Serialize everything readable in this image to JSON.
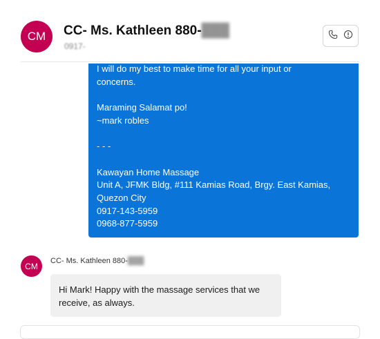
{
  "colors": {
    "avatar": "#c30052",
    "outgoing_bubble": "#0a74d9",
    "incoming_bubble": "#f0f0f0",
    "divider": "#e6e6e6"
  },
  "header": {
    "avatar_initials": "CM",
    "chat_name": "CC- Ms. Kathleen 880-",
    "chat_subtitle": "0917-",
    "call_icon": "phone-icon",
    "info_icon": "info-icon"
  },
  "outgoing_message": {
    "lines": [
      "I will do my best to make time for all your input or",
      "concerns.",
      "",
      "Maraming Salamat po!",
      "~mark robles",
      "",
      "- - -",
      "",
      "Kawayan Home Massage",
      "Unit A, JFMK Bldg, #111 Kamias Road, Brgy. East Kamias,",
      "Quezon City",
      "0917-143-5959",
      "0968-877-5959"
    ]
  },
  "incoming_message": {
    "avatar_initials": "CM",
    "sender": "CC- Ms. Kathleen 880-",
    "text": "Hi Mark! Happy with the massage services that we receive, as always."
  }
}
